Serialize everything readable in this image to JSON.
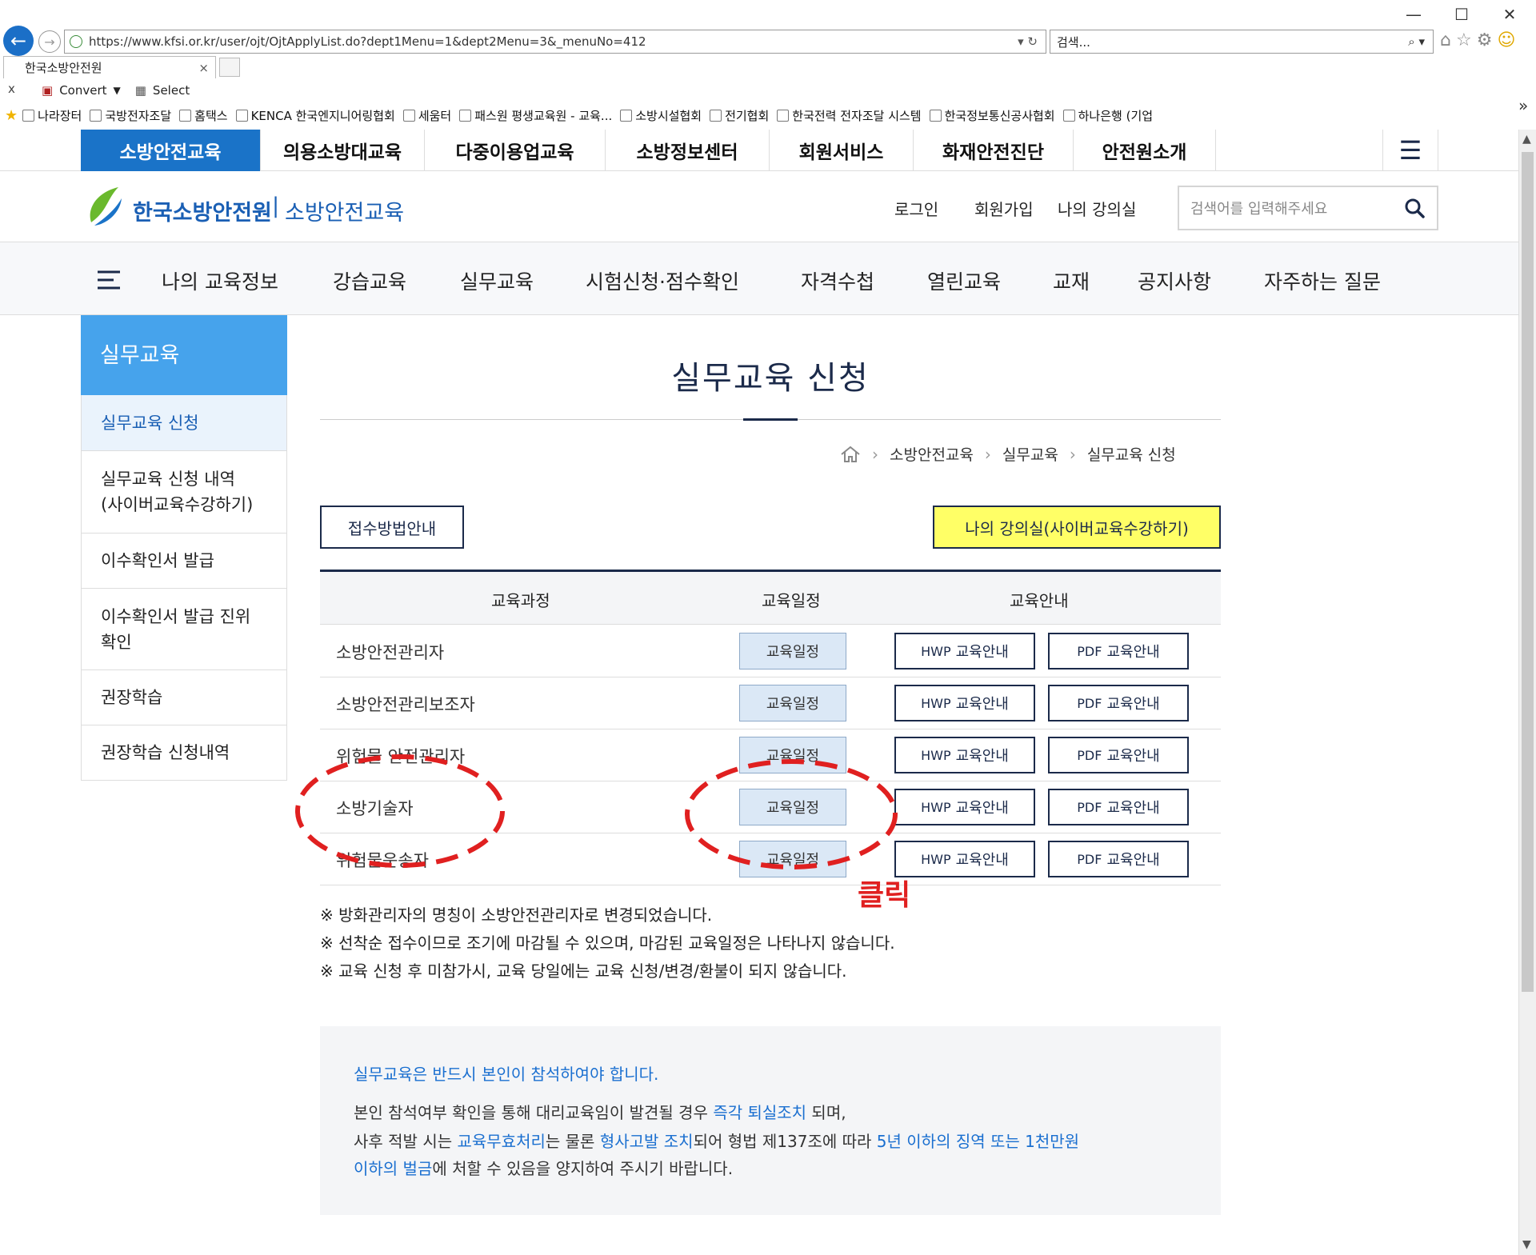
{
  "browser": {
    "url": "https://www.kfsi.or.kr/user/ojt/OjtApplyList.do?dept1Menu=1&dept2Menu=3&_menuNo=412",
    "search_placeholder": "검색...",
    "tab_title": "한국소방안전원",
    "toolbar": {
      "convert": "Convert",
      "select": "Select"
    },
    "bookmarks": [
      "나라장터",
      "국방전자조달",
      "홈택스",
      "KENCA 한국엔지니어링협회",
      "세움터",
      "패스원 평생교육원 - 교육...",
      "소방시설협회",
      "전기협회",
      "한국전력 전자조달 시스템",
      "한국정보통신공사협회",
      "하나은행 (기업"
    ],
    "close_x": "x",
    "more": "»"
  },
  "topmenu": {
    "items": [
      "소방안전교육",
      "의용소방대교육",
      "다중이용업교육",
      "소방정보센터",
      "회원서비스",
      "화재안전진단",
      "안전원소개"
    ]
  },
  "header": {
    "logo_text": "한국소방안전원",
    "logo_divider": "|",
    "logo_sub": "소방안전교육",
    "links": [
      "로그인",
      "회원가입",
      "나의 강의실"
    ],
    "search_placeholder": "검색어를 입력해주세요"
  },
  "mainnav": {
    "items": [
      "나의 교육정보",
      "강습교육",
      "실무교육",
      "시험신청·점수확인",
      "자격수첩",
      "열린교육",
      "교재",
      "공지사항",
      "자주하는 질문"
    ]
  },
  "sidebar": {
    "title": "실무교육",
    "items": [
      "실무교육 신청",
      "실무교육 신청 내역\n(사이버교육수강하기)",
      "이수확인서 발급",
      "이수확인서 발급 진위\n확인",
      "권장학습",
      "권장학습 신청내역"
    ]
  },
  "content": {
    "page_title": "실무교육 신청",
    "breadcrumb": [
      "소방안전교육",
      "실무교육",
      "실무교육 신청"
    ],
    "btn_method": "접수방법안내",
    "btn_myclass": "나의 강의실(사이버교육수강하기)",
    "table": {
      "headers": [
        "교육과정",
        "교육일정",
        "교육안내"
      ],
      "rows": [
        {
          "name": "소방안전관리자",
          "schedule": "교육일정",
          "hwp_pre": "HWP",
          "hwp": "교육안내",
          "pdf_pre": "PDF",
          "pdf": "교육안내"
        },
        {
          "name": "소방안전관리보조자",
          "schedule": "교육일정",
          "hwp_pre": "HWP",
          "hwp": "교육안내",
          "pdf_pre": "PDF",
          "pdf": "교육안내"
        },
        {
          "name": "위험물 안전관리자",
          "schedule": "교육일정",
          "hwp_pre": "HWP",
          "hwp": "교육안내",
          "pdf_pre": "PDF",
          "pdf": "교육안내"
        },
        {
          "name": "소방기술자",
          "schedule": "교육일정",
          "hwp_pre": "HWP",
          "hwp": "교육안내",
          "pdf_pre": "PDF",
          "pdf": "교육안내"
        },
        {
          "name": "위험물운송자",
          "schedule": "교육일정",
          "hwp_pre": "HWP",
          "hwp": "교육안내",
          "pdf_pre": "PDF",
          "pdf": "교육안내"
        }
      ]
    },
    "notes": [
      "※ 방화관리자의 명칭이 소방안전관리자로 변경되었습니다.",
      "※ 선착순 접수이므로 조기에 마감될 수 있으며, 마감된 교육일정은 나타나지 않습니다.",
      "※ 교육 신청 후 미참가시, 교육 당일에는 교육 신청/변경/환불이 되지 않습니다."
    ],
    "info": {
      "title": "실무교육은 반드시 본인이 참석하여야 합니다.",
      "l1_a": "본인 참석여부 확인을 통해 대리교육임이 발견될 경우 ",
      "l1_b": "즉각 퇴실조치",
      "l1_c": " 되며,",
      "l2_a": "사후 적발 시는 ",
      "l2_b": "교육무효처리",
      "l2_c": "는 물론 ",
      "l2_d": "형사고발 조치",
      "l2_e": "되어 형법 제137조에 따라 ",
      "l2_f": "5년 이하의 징역 또는 1천만원",
      "l3_a": "이하의 벌금",
      "l3_b": "에 처할 수 있음을 양지하여 주시기 바랍니다."
    }
  },
  "annotation": {
    "click_label": "클릭",
    "color": "#e02020"
  },
  "colors": {
    "accent": "#1a73c8",
    "navy": "#1b2a4a",
    "sidebar_title": "#46a3ec",
    "yellow": "#ffff66",
    "link_blue": "#1a6fd0"
  }
}
